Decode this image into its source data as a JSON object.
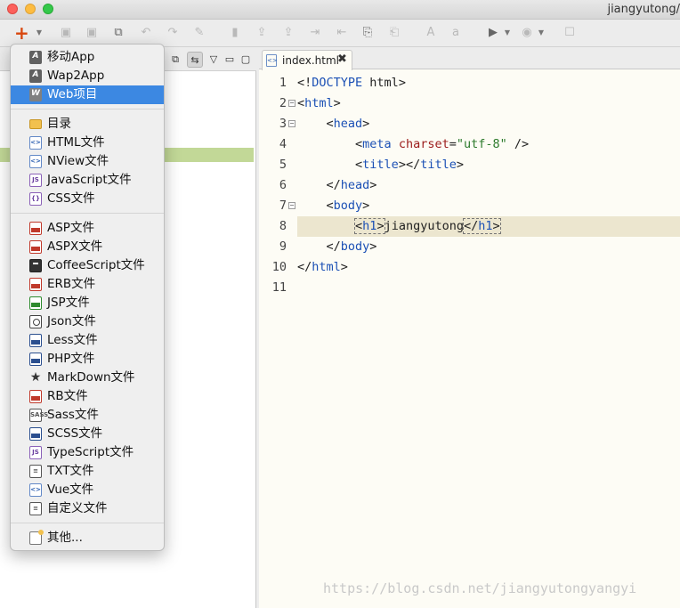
{
  "window": {
    "title": "jiangyutong/"
  },
  "toolbar": {
    "new_icon": "plus-icon",
    "new_caret": "chevron-down-icon"
  },
  "menu": {
    "groups": [
      [
        {
          "label": "移动App",
          "icon": "A",
          "kind": "app",
          "selected": false
        },
        {
          "label": "Wap2App",
          "icon": "A",
          "kind": "app",
          "selected": false
        },
        {
          "label": "Web项目",
          "icon": "W",
          "kind": "web",
          "selected": true
        }
      ],
      [
        {
          "label": "目录",
          "icon": "",
          "kind": "folder"
        },
        {
          "label": "HTML文件",
          "icon": "<>",
          "kind": "doc-blue"
        },
        {
          "label": "NView文件",
          "icon": "<>",
          "kind": "doc-blue"
        },
        {
          "label": "JavaScript文件",
          "icon": "JS",
          "kind": "doc-purple"
        },
        {
          "label": "CSS文件",
          "icon": "{}",
          "kind": "doc-purple"
        }
      ],
      [
        {
          "label": "ASP文件",
          "icon": "ASP",
          "kind": "doc-red"
        },
        {
          "label": "ASPX文件",
          "icon": "ASP",
          "kind": "doc-red"
        },
        {
          "label": "CoffeeScript文件",
          "icon": "",
          "kind": "doc-dark"
        },
        {
          "label": "ERB文件",
          "icon": "ERB",
          "kind": "doc-red"
        },
        {
          "label": "JSP文件",
          "icon": "JSP",
          "kind": "doc-green"
        },
        {
          "label": "Json文件",
          "icon": "",
          "kind": "json"
        },
        {
          "label": "Less文件",
          "icon": "LESS",
          "kind": "doc-navy"
        },
        {
          "label": "PHP文件",
          "icon": "PHP",
          "kind": "doc-navy"
        },
        {
          "label": "MarkDown文件",
          "icon": "★",
          "kind": "star"
        },
        {
          "label": "RB文件",
          "icon": "RB",
          "kind": "doc-red"
        },
        {
          "label": "Sass文件",
          "icon": "SASS",
          "kind": "doc-gray"
        },
        {
          "label": "SCSS文件",
          "icon": "SCSS",
          "kind": "doc-navy"
        },
        {
          "label": "TypeScript文件",
          "icon": "JS",
          "kind": "doc-purple"
        },
        {
          "label": "TXT文件",
          "icon": "≡",
          "kind": "doc-gray"
        },
        {
          "label": "Vue文件",
          "icon": "<>",
          "kind": "doc-blue"
        },
        {
          "label": "自定义文件",
          "icon": "≡",
          "kind": "doc-gray"
        }
      ],
      [
        {
          "label": "其他...",
          "icon": "",
          "kind": "other"
        }
      ]
    ]
  },
  "editor": {
    "tab": {
      "name": "index.html",
      "close": "✖"
    },
    "lines": [
      {
        "num": "1",
        "fold": false,
        "parts": [
          [
            "bracket",
            "<!"
          ],
          [
            "doc",
            "DOCTYPE"
          ],
          [
            "text",
            " html"
          ],
          [
            "bracket",
            ">"
          ]
        ]
      },
      {
        "num": "2",
        "fold": true,
        "parts": [
          [
            "bracket",
            "<"
          ],
          [
            "tag",
            "html"
          ],
          [
            "bracket",
            ">"
          ]
        ]
      },
      {
        "num": "3",
        "fold": true,
        "parts": [
          [
            "text",
            "    "
          ],
          [
            "bracket",
            "<"
          ],
          [
            "tag",
            "head"
          ],
          [
            "bracket",
            ">"
          ]
        ]
      },
      {
        "num": "4",
        "fold": false,
        "parts": [
          [
            "text",
            "        "
          ],
          [
            "bracket",
            "<"
          ],
          [
            "tag",
            "meta"
          ],
          [
            "text",
            " "
          ],
          [
            "attr",
            "charset"
          ],
          [
            "text",
            "="
          ],
          [
            "str",
            "\"utf-8\""
          ],
          [
            "text",
            " "
          ],
          [
            "bracket",
            "/>"
          ]
        ]
      },
      {
        "num": "5",
        "fold": false,
        "parts": [
          [
            "text",
            "        "
          ],
          [
            "bracket",
            "<"
          ],
          [
            "tag",
            "title"
          ],
          [
            "bracket",
            "></"
          ],
          [
            "tag",
            "title"
          ],
          [
            "bracket",
            ">"
          ]
        ]
      },
      {
        "num": "6",
        "fold": false,
        "parts": [
          [
            "text",
            "    "
          ],
          [
            "bracket",
            "</"
          ],
          [
            "tag",
            "head"
          ],
          [
            "bracket",
            ">"
          ]
        ]
      },
      {
        "num": "7",
        "fold": true,
        "parts": [
          [
            "text",
            "    "
          ],
          [
            "bracket",
            "<"
          ],
          [
            "tag",
            "body"
          ],
          [
            "bracket",
            ">"
          ]
        ]
      },
      {
        "num": "8",
        "fold": false,
        "current": true,
        "parts": [
          [
            "text",
            "        "
          ],
          [
            "matchopen",
            "<h1>"
          ],
          [
            "text",
            "jiangyutong"
          ],
          [
            "matchclose",
            "</h1>"
          ]
        ]
      },
      {
        "num": "9",
        "fold": false,
        "parts": [
          [
            "text",
            "    "
          ],
          [
            "bracket",
            "</"
          ],
          [
            "tag",
            "body"
          ],
          [
            "bracket",
            ">"
          ]
        ]
      },
      {
        "num": "10",
        "fold": false,
        "parts": [
          [
            "bracket",
            "</"
          ],
          [
            "tag",
            "html"
          ],
          [
            "bracket",
            ">"
          ]
        ]
      },
      {
        "num": "11",
        "fold": false,
        "parts": []
      }
    ]
  },
  "watermark": "https://blog.csdn.net/jiangyutongyangyi"
}
